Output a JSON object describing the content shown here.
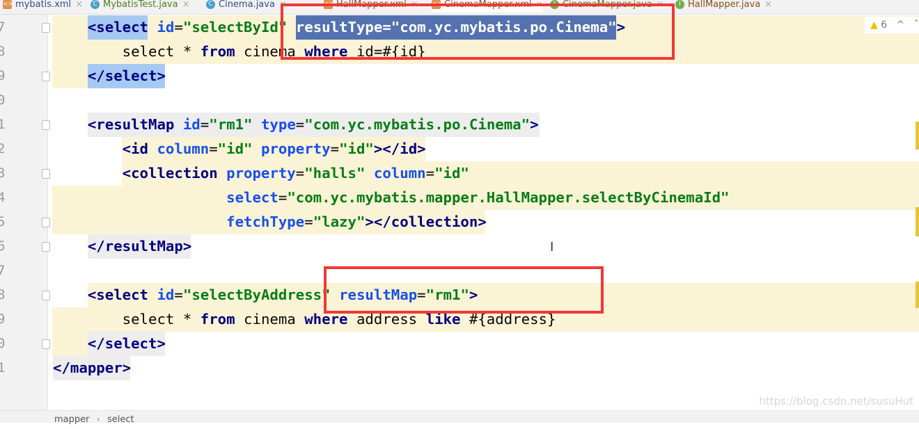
{
  "tabs": [
    {
      "label": "mybatis.xml",
      "icon": "xml-file-icon"
    },
    {
      "label": "MybatisTest.java",
      "icon": "class-icon"
    },
    {
      "label": "Cinema.java",
      "icon": "class-icon"
    },
    {
      "label": "HallMapper.xml",
      "icon": "xml-file-icon"
    },
    {
      "label": "CinemaMapper.xml",
      "icon": "xml-file-icon"
    },
    {
      "label": "CinemaMapper.java",
      "icon": "interface-icon"
    },
    {
      "label": "HallMapper.java",
      "icon": "interface-icon"
    }
  ],
  "inspections": {
    "warning_count": "6",
    "icon": "warning-triangle-icon"
  },
  "line_numbers": [
    "7",
    "8",
    "9",
    "0",
    "1",
    "2",
    "3",
    "4",
    "5",
    "6",
    "7",
    "8",
    "9",
    "0",
    "1"
  ],
  "code_lines": [
    [
      [
        "tag",
        "<select "
      ],
      [
        "attr",
        "id"
      ],
      [
        "txt",
        "="
      ],
      [
        "val",
        "\"selectById\" "
      ],
      [
        "sel",
        "resultType=\"com.yc.mybatis.po.Cinema\""
      ],
      [
        "tag",
        ">"
      ]
    ],
    [
      [
        "txt",
        "    select * "
      ],
      [
        "kw",
        "from"
      ],
      [
        "txt",
        " cinema "
      ],
      [
        "kw",
        "where"
      ],
      [
        "txt",
        " id=#{id}"
      ]
    ],
    [
      [
        "tag",
        "</select>"
      ]
    ],
    [],
    [
      [
        "tag",
        "<resultMap "
      ],
      [
        "attr",
        "id"
      ],
      [
        "txt",
        "="
      ],
      [
        "val",
        "\"rm1\" "
      ],
      [
        "attr",
        "type"
      ],
      [
        "txt",
        "="
      ],
      [
        "val",
        "\"com.yc.mybatis.po.Cinema\""
      ],
      [
        "tag",
        ">"
      ]
    ],
    [
      [
        "tag",
        "    <id "
      ],
      [
        "attr",
        "column"
      ],
      [
        "txt",
        "="
      ],
      [
        "val",
        "\"id\" "
      ],
      [
        "attr",
        "property"
      ],
      [
        "txt",
        "="
      ],
      [
        "val",
        "\"id\""
      ],
      [
        "tag",
        "></id>"
      ]
    ],
    [
      [
        "tag",
        "    <collection "
      ],
      [
        "attr",
        "property"
      ],
      [
        "txt",
        "="
      ],
      [
        "val",
        "\"halls\" "
      ],
      [
        "attr",
        "column"
      ],
      [
        "txt",
        "="
      ],
      [
        "val",
        "\"id\""
      ]
    ],
    [
      [
        "txt",
        "                "
      ],
      [
        "attr",
        "select"
      ],
      [
        "txt",
        "="
      ],
      [
        "val",
        "\"com.yc.mybatis.mapper.HallMapper.selectByCinemaId\""
      ]
    ],
    [
      [
        "txt",
        "                "
      ],
      [
        "attr",
        "fetchType"
      ],
      [
        "txt",
        "="
      ],
      [
        "val",
        "\"lazy\""
      ],
      [
        "tag",
        "></collection>"
      ]
    ],
    [
      [
        "tag",
        "</resultMap>"
      ]
    ],
    [],
    [
      [
        "tag",
        "<select "
      ],
      [
        "attr",
        "id"
      ],
      [
        "txt",
        "="
      ],
      [
        "val",
        "\"selectByAddress\" "
      ],
      [
        "attr",
        "resultMap"
      ],
      [
        "txt",
        "="
      ],
      [
        "val",
        "\"rm1\""
      ],
      [
        "tag",
        ">"
      ]
    ],
    [
      [
        "txt",
        "    select * "
      ],
      [
        "kw",
        "from"
      ],
      [
        "txt",
        " cinema "
      ],
      [
        "kw",
        "where"
      ],
      [
        "txt",
        " address "
      ],
      [
        "kw",
        "like"
      ],
      [
        "txt",
        " #{address}"
      ]
    ],
    [
      [
        "tag",
        "</select>"
      ]
    ],
    [
      [
        "tag",
        "</mapper>"
      ]
    ]
  ],
  "breadcrumb": [
    "mapper",
    "select"
  ],
  "breadcrumb_separator": "›",
  "watermark": "https://blog.csdn.net/susuHut",
  "colors": {
    "highlight_box": "#f03838",
    "selection": "#5472b0",
    "tag": "#000080",
    "attribute": "#1750eb",
    "value": "#067d17"
  }
}
